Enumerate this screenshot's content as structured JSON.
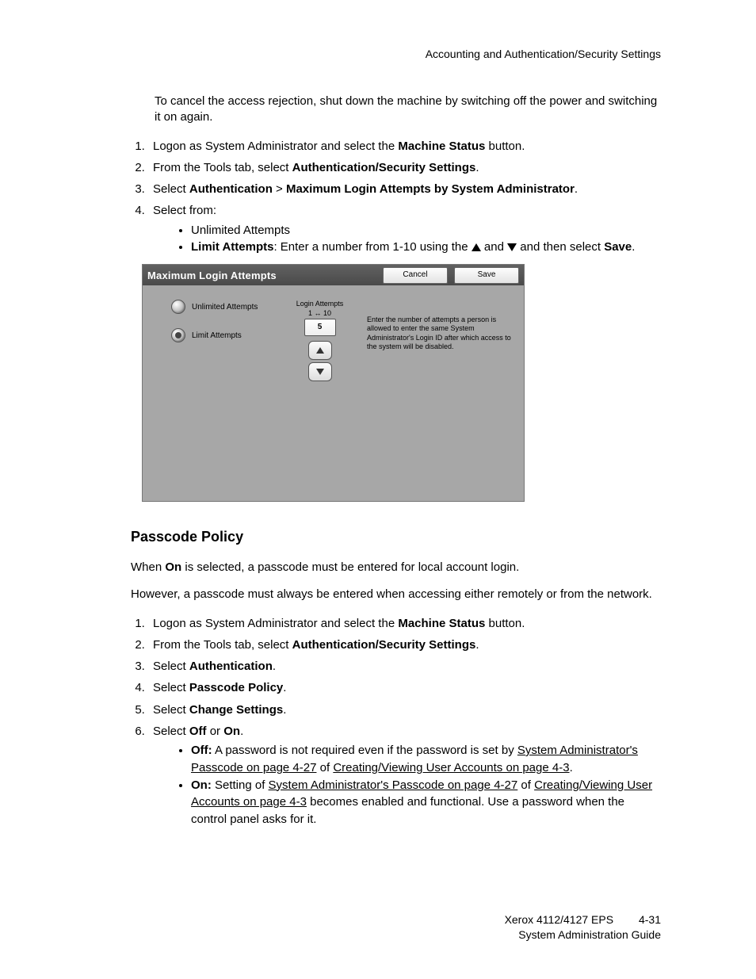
{
  "header": {
    "running_title": "Accounting and Authentication/Security Settings"
  },
  "intro": {
    "p1": "To cancel the access rejection, shut down the machine by switching off the power and switching it on again."
  },
  "steps_a": {
    "s1_a": "Logon as System Administrator and select the ",
    "s1_b": "Machine Status",
    "s1_c": " button.",
    "s2_a": "From the Tools tab, select ",
    "s2_b": "Authentication/Security Settings",
    "s2_c": ".",
    "s3_a": "Select ",
    "s3_b": "Authentication",
    "s3_c": " > ",
    "s3_d": "Maximum Login Attempts by System Administrator",
    "s3_e": ".",
    "s4": "Select from:"
  },
  "bullets_a": {
    "b1": "Unlimited Attempts",
    "b2_a": "Limit Attempts",
    "b2_b": ": Enter a number from 1-10 using the ",
    "b2_c": " and ",
    "b2_d": " and then select ",
    "b2_e": "Save",
    "b2_f": "."
  },
  "device_ui": {
    "title": "Maximum Login Attempts",
    "cancel": "Cancel",
    "save": "Save",
    "opt_unlimited": "Unlimited Attempts",
    "opt_limit": "Limit Attempts",
    "mid_label1": "Login Attempts",
    "mid_label2": "1 ↔ 10",
    "value": "5",
    "help": "Enter the number of attempts a person is allowed to enter the same System Administrator's Login ID after which access to the system will be disabled."
  },
  "section2": {
    "heading": "Passcode Policy",
    "p1_a": "When ",
    "p1_b": "On",
    "p1_c": " is selected, a passcode must be entered for local account login.",
    "p2": "However, a passcode must always be entered when accessing either remotely or from the network."
  },
  "steps_b": {
    "s1_a": "Logon as System Administrator and select the ",
    "s1_b": "Machine Status",
    "s1_c": " button.",
    "s2_a": "From the Tools tab, select ",
    "s2_b": "Authentication/Security Settings",
    "s2_c": ".",
    "s3_a": "Select ",
    "s3_b": "Authentication",
    "s3_c": ".",
    "s4_a": "Select ",
    "s4_b": "Passcode Policy",
    "s4_c": ".",
    "s5_a": "Select ",
    "s5_b": "Change Settings",
    "s5_c": ".",
    "s6_a": "Select ",
    "s6_b": "Off",
    "s6_c": " or ",
    "s6_d": "On",
    "s6_e": "."
  },
  "bullets_b": {
    "off_a": "Off:",
    "off_b": "  A password is not required even if the password is set by ",
    "off_l1": "System Administrator's Passcode on page 4-27",
    "off_c": " of ",
    "off_l2": "Creating/Viewing User Accounts on page 4-3",
    "off_d": ".",
    "on_a": "On:",
    "on_b": "  Setting of ",
    "on_l1": "System Administrator's Passcode on page 4-27",
    "on_c": " of ",
    "on_l2": "Creating/Viewing User Accounts on page 4-3",
    "on_d": " becomes enabled and functional.  Use a password when the control panel asks for it."
  },
  "footer": {
    "line1a": "Xerox 4112/4127 EPS",
    "line1b": "4-31",
    "line2": "System Administration Guide"
  }
}
